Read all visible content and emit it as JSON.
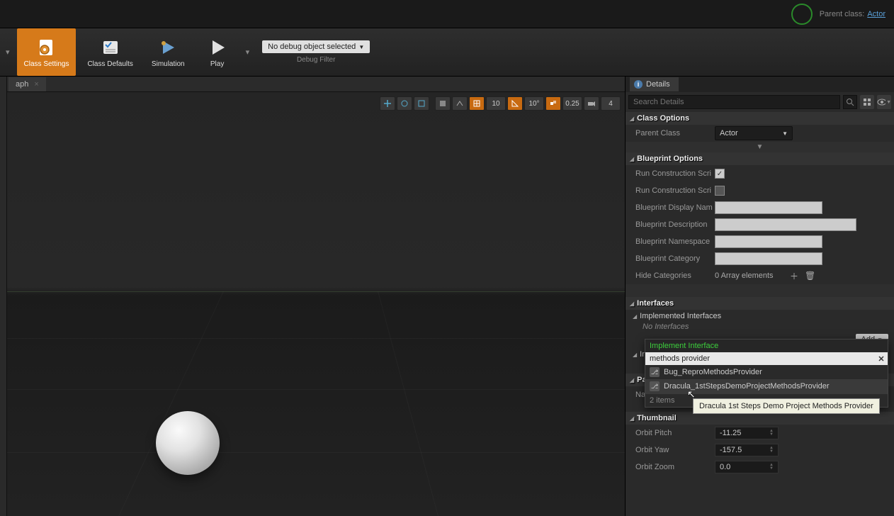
{
  "topbar": {
    "parent_class_label": "Parent class:",
    "parent_class_value": "Actor"
  },
  "toolbar": {
    "class_settings": "Class Settings",
    "class_defaults": "Class Defaults",
    "simulation": "Simulation",
    "play": "Play",
    "debug_selected": "No debug object selected",
    "debug_filter": "Debug Filter"
  },
  "tabs": {
    "graph": "aph",
    "details": "Details"
  },
  "viewport_toolbar": {
    "v1": "10",
    "v2": "10°",
    "v3": "0.25",
    "v4": "4"
  },
  "details": {
    "search_placeholder": "Search Details",
    "sections": {
      "class_options": "Class Options",
      "blueprint_options": "Blueprint Options",
      "interfaces": "Interfaces",
      "implemented_interfaces": "Implemented Interfaces",
      "inherited": "Inh",
      "packaging": "Pa",
      "thumbnail": "Thumbnail"
    },
    "props": {
      "parent_class": "Parent Class",
      "parent_class_value": "Actor",
      "run_cons_1": "Run Construction Scri",
      "run_cons_2": "Run Construction Scri",
      "bp_display_name": "Blueprint Display Nam",
      "bp_description": "Blueprint Description",
      "bp_namespace": "Blueprint Namespace",
      "bp_category": "Blueprint Category",
      "hide_categories": "Hide Categories",
      "hide_categories_value": "0 Array elements",
      "no_interfaces": "No Interfaces",
      "add": "Add",
      "na": "Na",
      "orbit_pitch": "Orbit Pitch",
      "orbit_pitch_value": "-11.25",
      "orbit_yaw": "Orbit Yaw",
      "orbit_yaw_value": "-157.5",
      "orbit_zoom": "Orbit Zoom",
      "orbit_zoom_value": "0.0"
    }
  },
  "popup": {
    "title": "Implement Interface",
    "search_value": "methods provider",
    "items": [
      "Bug_ReproMethodsProvider",
      "Dracula_1stStepsDemoProjectMethodsProvider"
    ],
    "footer": "2 items"
  },
  "tooltip": "Dracula 1st Steps Demo Project Methods Provider"
}
